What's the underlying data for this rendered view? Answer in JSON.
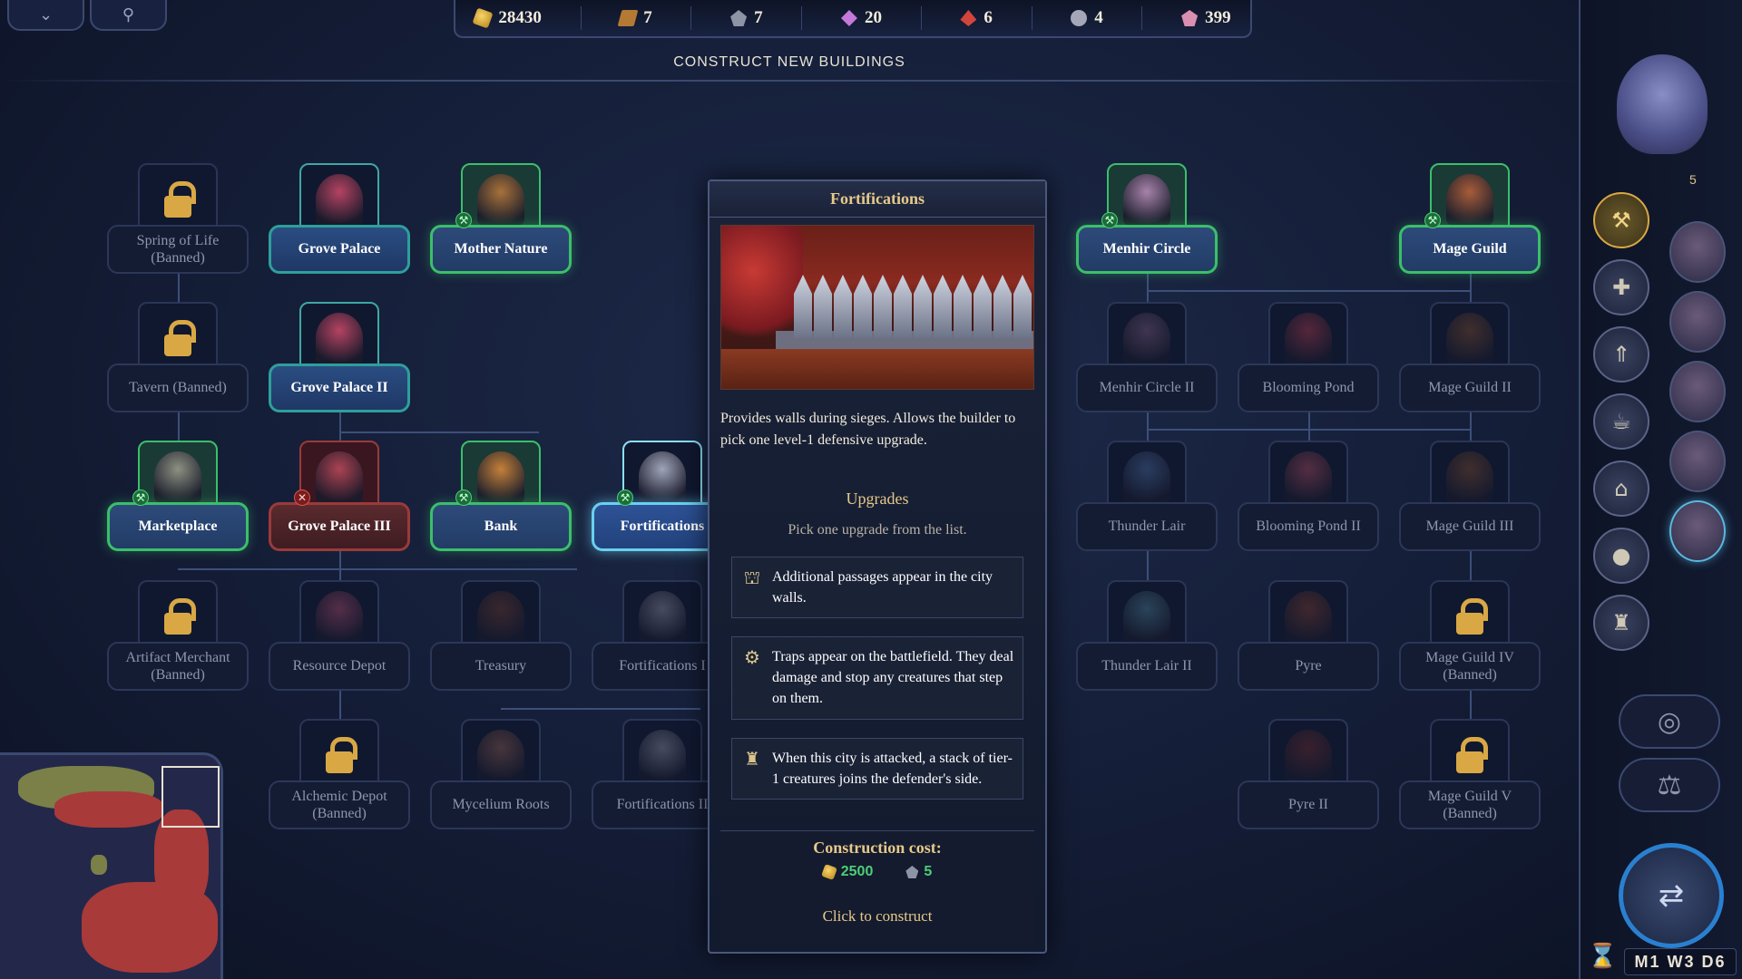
{
  "top_buttons": [
    {
      "name": "collapse-menu-button",
      "icon": "chevron-down-icon",
      "glyph": "⌄"
    },
    {
      "name": "map-pin-button",
      "icon": "map-pin-icon",
      "glyph": "⚲"
    }
  ],
  "resources": [
    {
      "name": "gold",
      "icon": "gold-icon",
      "value": "28430"
    },
    {
      "name": "wood",
      "icon": "wood-icon",
      "value": "7"
    },
    {
      "name": "ore",
      "icon": "ore-icon",
      "value": "7"
    },
    {
      "name": "crystal",
      "icon": "crystal-icon",
      "value": "20"
    },
    {
      "name": "mercury",
      "icon": "mercury-icon",
      "value": "6"
    },
    {
      "name": "gem",
      "icon": "gem-icon",
      "value": "4"
    },
    {
      "name": "dust",
      "icon": "dust-icon",
      "value": "399"
    }
  ],
  "screen_title": "CONSTRUCT NEW BUILDINGS",
  "buildings": [
    {
      "id": "spring-of-life",
      "label": "Spring of Life (Banned)",
      "state": "locked",
      "badge": ""
    },
    {
      "id": "grove-palace",
      "label": "Grove Palace",
      "state": "current",
      "badge": ""
    },
    {
      "id": "mother-nature",
      "label": "Mother Nature",
      "state": "built",
      "badge": "build"
    },
    {
      "id": "menhir-circle",
      "label": "Menhir Circle",
      "state": "built",
      "badge": "build"
    },
    {
      "id": "mage-guild",
      "label": "Mage Guild",
      "state": "built",
      "badge": "build"
    },
    {
      "id": "tavern",
      "label": "Tavern (Banned)",
      "state": "locked",
      "badge": ""
    },
    {
      "id": "grove-palace-ii",
      "label": "Grove Palace II",
      "state": "current",
      "badge": ""
    },
    {
      "id": "menhir-circle-ii",
      "label": "Menhir Circle II",
      "state": "unavailable",
      "badge": ""
    },
    {
      "id": "blooming-pond",
      "label": "Blooming Pond",
      "state": "unavailable",
      "badge": ""
    },
    {
      "id": "mage-guild-ii",
      "label": "Mage Guild II",
      "state": "unavailable",
      "badge": ""
    },
    {
      "id": "marketplace",
      "label": "Marketplace",
      "state": "built",
      "badge": "build"
    },
    {
      "id": "grove-palace-iii",
      "label": "Grove Palace III",
      "state": "blocked",
      "badge": "no"
    },
    {
      "id": "bank",
      "label": "Bank",
      "state": "built",
      "badge": "build"
    },
    {
      "id": "fortifications",
      "label": "Fortifications",
      "state": "selected",
      "badge": "build"
    },
    {
      "id": "thunder-lair",
      "label": "Thunder Lair",
      "state": "unavailable",
      "badge": ""
    },
    {
      "id": "blooming-pond-ii",
      "label": "Blooming Pond II",
      "state": "unavailable",
      "badge": ""
    },
    {
      "id": "mage-guild-iii",
      "label": "Mage Guild III",
      "state": "unavailable",
      "badge": ""
    },
    {
      "id": "artifact-merchant",
      "label": "Artifact Merchant (Banned)",
      "state": "locked",
      "badge": ""
    },
    {
      "id": "resource-depot",
      "label": "Resource Depot",
      "state": "unavailable",
      "badge": ""
    },
    {
      "id": "treasury",
      "label": "Treasury",
      "state": "unavailable",
      "badge": ""
    },
    {
      "id": "fortifications-ii",
      "label": "Fortifications I",
      "state": "unavailable",
      "badge": ""
    },
    {
      "id": "thunder-lair-ii",
      "label": "Thunder Lair II",
      "state": "unavailable",
      "badge": ""
    },
    {
      "id": "pyre",
      "label": "Pyre",
      "state": "unavailable",
      "badge": ""
    },
    {
      "id": "mage-guild-iv",
      "label": "Mage Guild IV (Banned)",
      "state": "locked",
      "badge": ""
    },
    {
      "id": "alchemic-depot",
      "label": "Alchemic Depot (Banned)",
      "state": "locked",
      "badge": ""
    },
    {
      "id": "mycelium-roots",
      "label": "Mycelium Roots",
      "state": "unavailable",
      "badge": ""
    },
    {
      "id": "fortifications-iii",
      "label": "Fortifications II",
      "state": "unavailable",
      "badge": ""
    },
    {
      "id": "pyre-ii",
      "label": "Pyre II",
      "state": "unavailable",
      "badge": ""
    },
    {
      "id": "mage-guild-v",
      "label": "Mage Guild V (Banned)",
      "state": "locked",
      "badge": ""
    }
  ],
  "popup": {
    "title": "Fortifications",
    "description": "Provides walls during sieges. Allows the builder to pick one level-1 defensive upgrade.",
    "upgrades_title": "Upgrades",
    "upgrades_subtitle": "Pick one upgrade from the list.",
    "upgrades": [
      {
        "icon": "gate-icon",
        "glyph": "⛫",
        "text": "Additional passages appear in the city walls."
      },
      {
        "icon": "trap-icon",
        "glyph": "⚙",
        "text": "Traps appear on the battlefield. They deal damage and stop any creatures that step on them."
      },
      {
        "icon": "reinforcement-icon",
        "glyph": "♜",
        "text": "When this city is attacked, a stack of tier-1 creatures joins the defender's side."
      }
    ],
    "cost_title": "Construction cost:",
    "cost": [
      {
        "icon": "gold-icon",
        "value": "2500"
      },
      {
        "icon": "ore-icon",
        "value": "5"
      }
    ],
    "construct_label": "Click to construct"
  },
  "sidebar": {
    "town_count": "5",
    "buttons": [
      {
        "name": "build-button",
        "icon": "hammer-icon",
        "glyph": "⚒"
      },
      {
        "name": "recruit-button",
        "icon": "add-unit-icon",
        "glyph": "✚"
      },
      {
        "name": "upgrade-button",
        "icon": "rank-up-icon",
        "glyph": "⇑"
      },
      {
        "name": "tavern-button",
        "icon": "mug-icon",
        "glyph": "☕"
      },
      {
        "name": "market-button",
        "icon": "market-icon",
        "glyph": "⌂"
      },
      {
        "name": "resources-button",
        "icon": "pouch-icon",
        "glyph": "●"
      },
      {
        "name": "fort-button",
        "icon": "tower-icon",
        "glyph": "♜"
      }
    ],
    "round_buttons": [
      {
        "name": "view-button",
        "icon": "target-icon",
        "glyph": "◎"
      },
      {
        "name": "balance-button",
        "icon": "scales-icon",
        "glyph": "⚖"
      }
    ],
    "end_turn_glyph": "⇄",
    "date": "M1 W3 D6",
    "hourglass_glyph": "⌛"
  },
  "colors": {
    "built_border": "#3bbf6a",
    "selected_border": "#6ad0f0",
    "blocked_border": "#9a3a3a",
    "gold_text": "#e6c98a",
    "cost_green": "#4ccf78"
  }
}
